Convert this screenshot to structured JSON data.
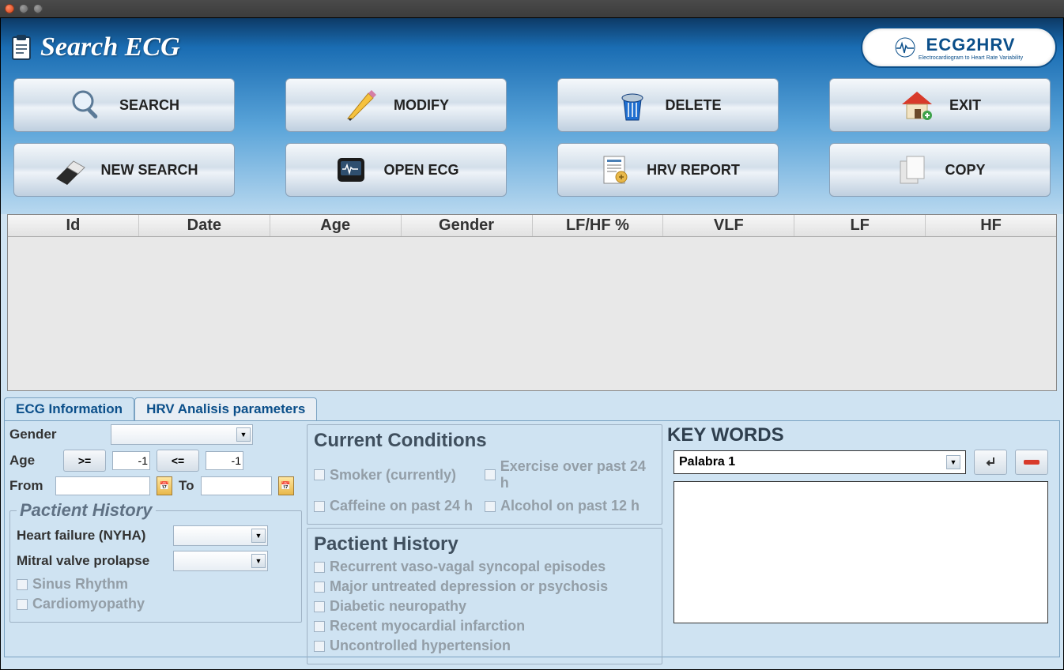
{
  "titlebar": {
    "close": "×",
    "min": "–",
    "max": "□"
  },
  "header": {
    "app_title": "Search ECG",
    "logo_main": "ECG2HRV",
    "logo_sub": "Electrocardiogram to Heart Rate Variability"
  },
  "buttons": {
    "search": "SEARCH",
    "modify": "MODIFY",
    "delete": "DELETE",
    "exit": "EXIT",
    "new_search": "NEW SEARCH",
    "open_ecg": "OPEN ECG",
    "hrv_report": "HRV REPORT",
    "copy": "COPY"
  },
  "table": {
    "headers": [
      "Id",
      "Date",
      "Age",
      "Gender",
      "LF/HF %",
      "VLF",
      "LF",
      "HF"
    ]
  },
  "tabs": {
    "ecg_info": "ECG Information",
    "hrv_params": "HRV Analisis parameters"
  },
  "filters": {
    "gender_label": "Gender",
    "gender_value": "",
    "age_label": "Age",
    "ge": ">=",
    "le": "<=",
    "age_from": "-1",
    "age_to": "-1",
    "from_label": "From",
    "to_label": "To",
    "from_value": "",
    "to_value": ""
  },
  "history_group_title": "Pactient History",
  "history_left": {
    "hf_label": "Heart failure (NYHA)",
    "hf_value": "",
    "mvp_label": "Mitral valve prolapse",
    "mvp_value": "",
    "sinus": "Sinus Rhythm",
    "cardio": "Cardiomyopathy"
  },
  "cc_title": "Current Conditions",
  "cc": {
    "smoker": "Smoker (currently)",
    "exercise": "Exercise over past 24 h",
    "caffeine": "Caffeine on past 24 h",
    "alcohol": "Alcohol on past 12 h"
  },
  "history_mid_title": "Pactient History",
  "history_mid": {
    "vaso": "Recurrent vaso-vagal syncopal episodes",
    "depress": "Major untreated depression or psychosis",
    "diabetic": "Diabetic neuropathy",
    "mi": "Recent myocardial infarction",
    "hyper": "Uncontrolled hypertension"
  },
  "keywords": {
    "title": "KEY WORDS",
    "selected": "Palabra 1"
  }
}
